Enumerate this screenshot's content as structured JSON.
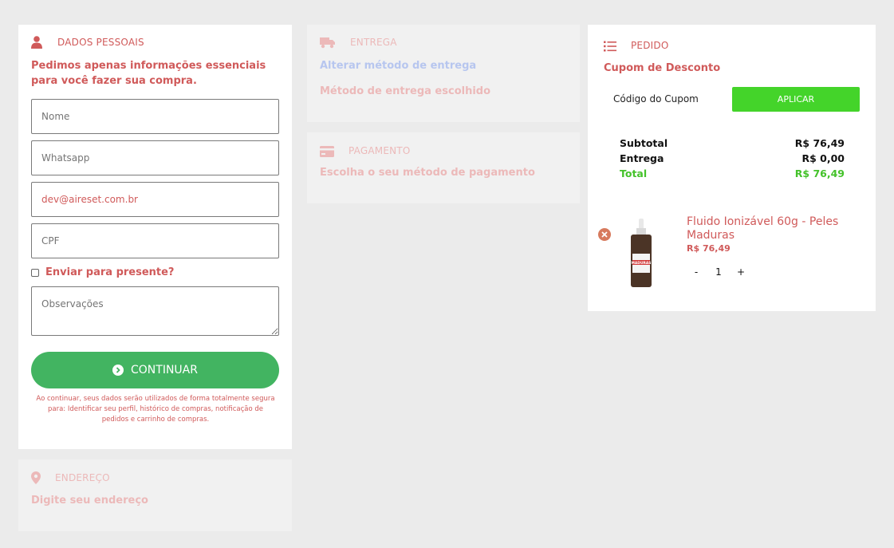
{
  "colors": {
    "accent": "#d05a5a",
    "green_button": "#42b461",
    "apply_button": "#44d42a",
    "total_green": "#44c22a",
    "faded": "#ecb9b9"
  },
  "personal": {
    "title": "DADOS PESSOAIS",
    "subtitle": "Pedimos apenas informações essenciais para você fazer sua compra.",
    "name_placeholder": "Nome",
    "whatsapp_placeholder": "Whatsapp",
    "email_value": "dev@aireset.com.br",
    "cpf_placeholder": "CPF",
    "gift_label": "Enviar para presente?",
    "notes_placeholder": "Observações",
    "continue_label": "CONTINUAR",
    "disclaimer": "Ao continuar, seus dados serão utilizados de forma totalmente segura para: Identificar seu perfil, histórico de compras, notificação de pedidos e carrinho de compras."
  },
  "address": {
    "title": "ENDEREÇO",
    "prompt": "Digite seu endereço"
  },
  "delivery": {
    "title": "ENTREGA",
    "change_link": "Alterar método de entrega",
    "chosen_label": "Método de entrega escolhido"
  },
  "payment": {
    "title": "PAGAMENTO",
    "prompt": "Escolha o seu método de pagamento"
  },
  "order": {
    "title": "PEDIDO",
    "coupon_title": "Cupom de Desconto",
    "coupon_placeholder": "Código do Cupom",
    "apply_label": "APLICAR",
    "subtotal_label": "Subtotal",
    "subtotal_value": "R$ 76,49",
    "delivery_label": "Entrega",
    "delivery_value": "R$ 0,00",
    "total_label": "Total",
    "total_value": "R$ 76,49",
    "item": {
      "name": "Fluido Ionizável 60g - Peles Maduras",
      "price": "R$ 76,49",
      "quantity": "1",
      "minus": "-",
      "plus": "+",
      "bottle_label": "MADURAS"
    }
  }
}
